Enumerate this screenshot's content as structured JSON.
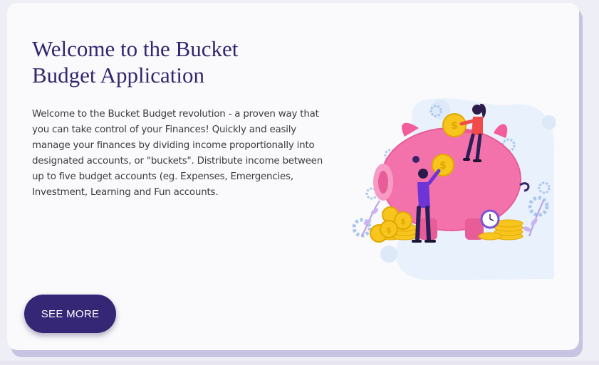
{
  "hero": {
    "title": "Welcome to the Bucket Budget Application",
    "description": "Welcome to the Bucket Budget revolution - a proven way that you can take control of your Finances! Quickly and easily manage your finances by dividing income proportionally into designated accounts, or \"buckets\". Distribute income between up to five budget accounts (eg. Expenses, Emergencies, Investment, Learning and Fun accounts.",
    "button_label": "SEE MORE"
  },
  "illustration": {
    "icon": "piggy-bank-with-coins-illustration"
  },
  "colors": {
    "accent": "#352676",
    "title": "#31266f",
    "card": "#fafafc",
    "card_shadow": "#c7c3e3",
    "piggy": "#f06aa4",
    "coin": "#f7c51e"
  }
}
